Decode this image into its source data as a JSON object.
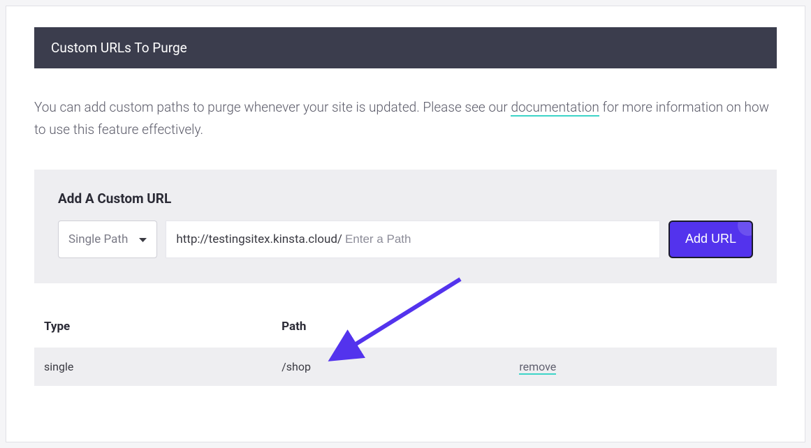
{
  "header": {
    "title": "Custom URLs To Purge"
  },
  "description": {
    "text_before": "You can add custom paths to purge whenever your site is updated. Please see our ",
    "link_text": "documentation",
    "text_after": " for more information on how to use this feature effectively."
  },
  "add_box": {
    "title": "Add A Custom URL",
    "type_select": {
      "selected": "Single Path"
    },
    "url_prefix": "http://testingsitex.kinsta.cloud/",
    "url_placeholder": "Enter a Path",
    "add_button_label": "Add URL"
  },
  "table": {
    "headers": {
      "type": "Type",
      "path": "Path"
    },
    "rows": [
      {
        "type": "single",
        "path": "/shop",
        "action": "remove"
      }
    ]
  },
  "colors": {
    "accent": "#5333ed",
    "teal_underline": "#3dd4c8",
    "header_bg": "#3b3d4d"
  }
}
